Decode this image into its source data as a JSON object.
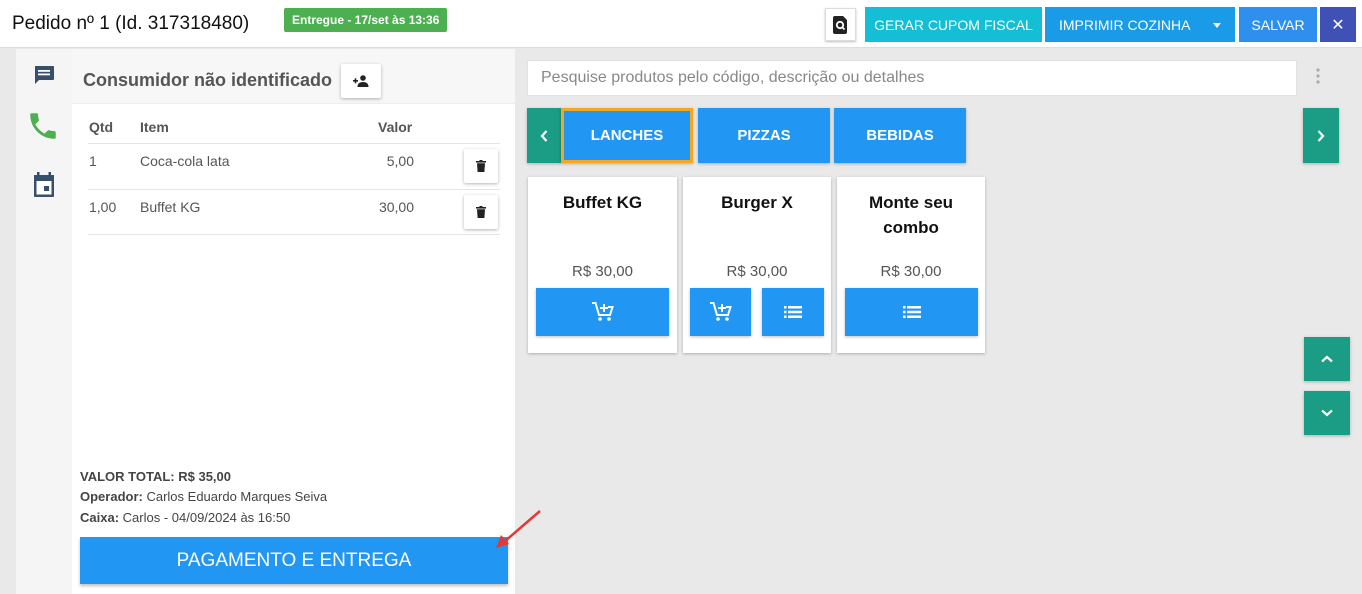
{
  "header": {
    "order_title": "Pedido nº 1 (Id. 317318480)",
    "status_badge": "Entregue - 17/set às 13:36",
    "cupom_label": "GERAR CUPOM FISCAL",
    "cozinha_label": "IMPRIMIR COZINHA",
    "salvar_label": "SALVAR",
    "close_label": "✕"
  },
  "rail": {
    "icons": [
      "chat-icon",
      "phone-icon",
      "calendar-icon"
    ]
  },
  "order": {
    "consumer": "Consumidor não identificado",
    "columns": {
      "qty": "Qtd",
      "item": "Item",
      "value": "Valor"
    },
    "rows": [
      {
        "qty": "1",
        "item": "Coca-cola lata",
        "value": "5,00"
      },
      {
        "qty": "1,00",
        "item": "Buffet KG",
        "value": "30,00"
      }
    ],
    "total_label": "VALOR TOTAL:",
    "total_value": "R$ 35,00",
    "operator_label": "Operador:",
    "operator_value": "Carlos Eduardo Marques Seiva",
    "caixa_label": "Caixa:",
    "caixa_value": "Carlos - 04/09/2024 às 16:50",
    "pay_button": "PAGAMENTO E ENTREGA"
  },
  "products": {
    "search_placeholder": "Pesquise produtos pelo código, descrição ou detalhes",
    "categories": [
      {
        "label": "LANCHES",
        "active": true
      },
      {
        "label": "PIZZAS",
        "active": false
      },
      {
        "label": "BEBIDAS",
        "active": false
      }
    ],
    "items": [
      {
        "name": "Buffet KG",
        "price": "R$ 30,00"
      },
      {
        "name": "Burger X",
        "price": "R$ 30,00"
      },
      {
        "name": "Monte seu combo",
        "price": "R$ 30,00"
      }
    ]
  },
  "colors": {
    "primary": "#2196f3",
    "teal": "#1b9c85",
    "cyan": "#14bfd6",
    "success": "#4caf50",
    "indigo": "#3f51b5",
    "highlight": "#f5a623",
    "annotation_arrow": "#e53935"
  }
}
